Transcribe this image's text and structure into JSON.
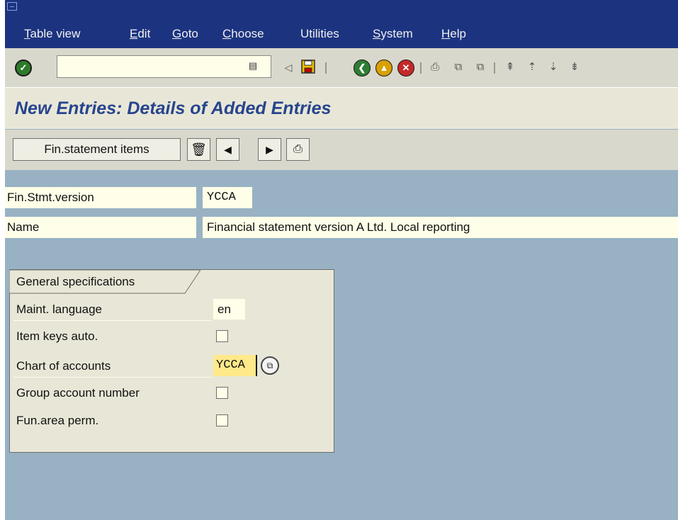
{
  "menubar": {
    "items": [
      {
        "label": "Table view",
        "accel": "T",
        "rest": "able view"
      },
      {
        "label": "Edit",
        "accel": "E",
        "rest": "dit"
      },
      {
        "label": "Goto",
        "accel": "G",
        "rest": "oto"
      },
      {
        "label": "Choose",
        "accel": "C",
        "rest": "hoose"
      },
      {
        "label": "Utilities",
        "accel": "",
        "rest": "Utilities"
      },
      {
        "label": "System",
        "accel": "S",
        "rest": "ystem"
      },
      {
        "label": "Help",
        "accel": "H",
        "rest": "elp"
      }
    ]
  },
  "toolbar": {
    "command_value": "",
    "icons": [
      "enter-icon",
      "command-dropdown-icon",
      "back-arrow-icon",
      "save-icon",
      "back-icon",
      "exit-icon",
      "cancel-icon",
      "print-icon",
      "find-icon",
      "find-next-icon",
      "first-page-icon",
      "previous-page-icon",
      "next-page-icon",
      "last-page-icon"
    ],
    "colors": {
      "back": "#2e7d32",
      "exit": "#d8a000",
      "cancel": "#c62828"
    }
  },
  "page": {
    "title": "New Entries: Details of Added Entries"
  },
  "app_toolbar": {
    "fin_button_label": "Fin.statement items",
    "icons": [
      "delete-icon",
      "previous-entry-icon",
      "next-entry-icon",
      "print-icon"
    ]
  },
  "header_fields": {
    "version_label": "Fin.Stmt.version",
    "version_value": "YCCA",
    "name_label": "Name",
    "name_value": "Financial statement version A Ltd. Local reporting"
  },
  "general": {
    "title": "General specifications",
    "maint_language_label": "Maint. language",
    "maint_language_value": "en",
    "item_keys_label": "Item keys auto.",
    "item_keys_checked": false,
    "chart_label": "Chart of accounts",
    "chart_value": "YCCA",
    "group_account_label": "Group account number",
    "group_account_checked": false,
    "fun_area_label": "Fun.area perm.",
    "fun_area_checked": false
  },
  "colors": {
    "menubar": "#1c3480",
    "background": "#98b2c4",
    "title": "#27448e",
    "input": "#fffee8",
    "highlight": "#ffe98a"
  }
}
